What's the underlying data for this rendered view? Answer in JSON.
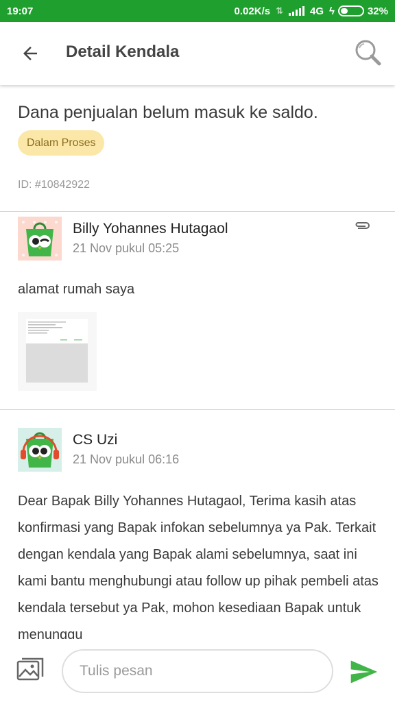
{
  "status_bar": {
    "time": "19:07",
    "net_speed": "0.02K/s",
    "network_type": "4G",
    "battery_percent": "32%",
    "battery_level": 0.32
  },
  "app_bar": {
    "title": "Detail Kendala",
    "back_icon": "arrow-back-icon",
    "search_icon": "search-icon"
  },
  "ticket": {
    "title": "Dana penjualan belum masuk ke saldo.",
    "status": "Dalam Proses",
    "id_label": "ID: #10842922"
  },
  "messages": [
    {
      "sender": "Billy Yohannes Hutagaol",
      "time": "21 Nov pukul 05:25",
      "text": "alamat rumah saya",
      "has_attachment": true,
      "attachment_icon": "paperclip-icon"
    },
    {
      "sender": "CS Uzi",
      "time": "21 Nov pukul 06:16",
      "text": "Dear Bapak Billy Yohannes Hutagaol, Terima kasih atas konfirmasi yang Bapak infokan sebelumnya ya Pak. Terkait dengan kendala yang Bapak alami sebelumnya, saat ini kami bantu menghubungi atau follow up pihak pembeli atas kendala tersebut ya Pak, mohon kesediaan Bapak untuk menunggu"
    }
  ],
  "composer": {
    "placeholder": "Tulis pesan",
    "gallery_icon": "image-gallery-icon",
    "send_icon": "send-icon"
  },
  "colors": {
    "status_bar": "#1fa02e",
    "accent_green": "#42b549",
    "badge_bg": "#fbe7a8",
    "badge_text": "#8a6d1f"
  }
}
